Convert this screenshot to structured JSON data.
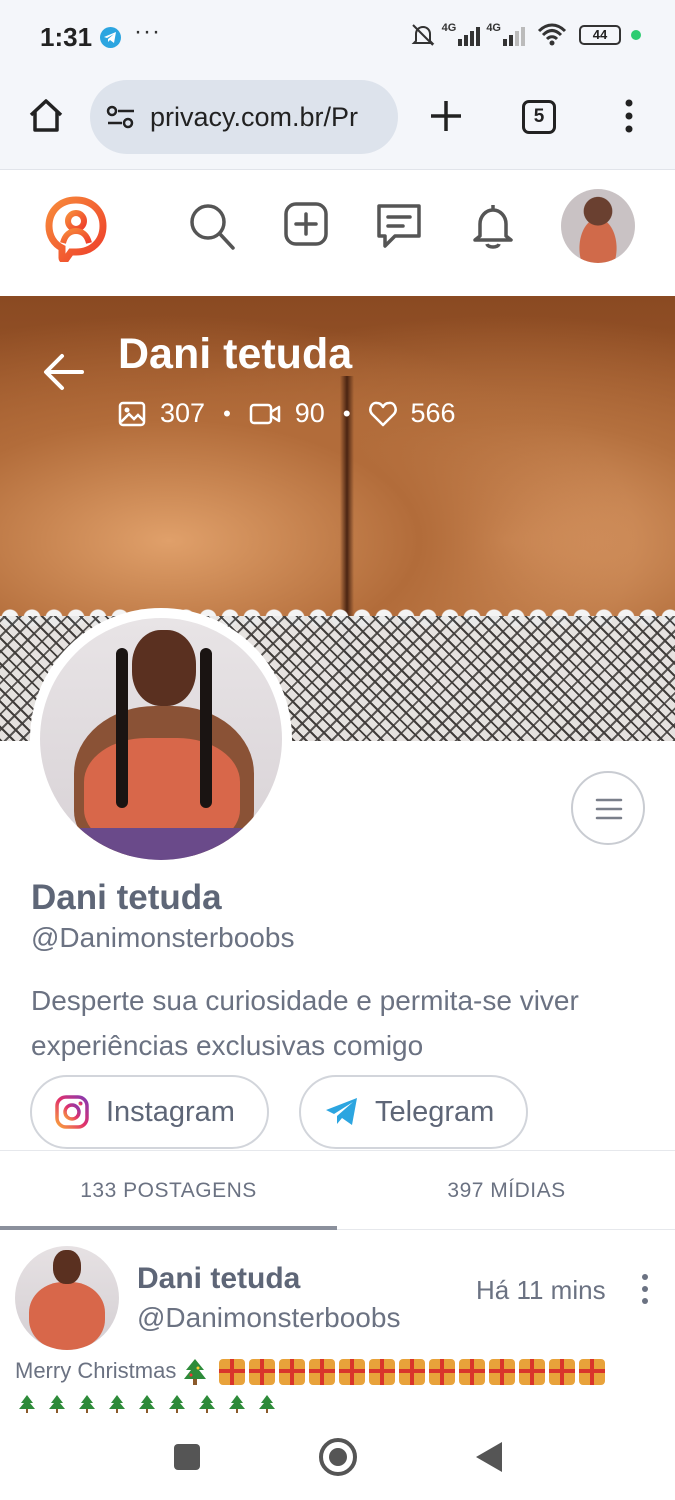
{
  "status_bar": {
    "time": "1:31",
    "more": "···",
    "network_1": "4G",
    "network_2": "4G",
    "battery": "44"
  },
  "browser": {
    "url": "privacy.com.br/Pr",
    "tab_count": "5"
  },
  "profile": {
    "cover_title": "Dani tetuda",
    "stats": {
      "photos": "307",
      "videos": "90",
      "likes": "566"
    },
    "name": "Dani tetuda",
    "handle": "@Danimonsterboobs",
    "bio": "Desperte sua curiosidade e permita-se viver experiências exclusivas comigo",
    "social": {
      "instagram_label": "Instagram",
      "telegram_label": "Telegram"
    }
  },
  "tabs": [
    {
      "label": "133 POSTAGENS",
      "active": true
    },
    {
      "label": "397 MÍDIAS",
      "active": false
    }
  ],
  "post": {
    "name": "Dani tetuda",
    "handle": "@Danimonsterboobs",
    "time": "Há 11 mins",
    "text": "Merry Christmas"
  },
  "colors": {
    "brand_orange": "#f0562b",
    "text_gray": "#6b7282",
    "status_green": "#2ecc71",
    "telegram_blue": "#2ca5e0"
  }
}
